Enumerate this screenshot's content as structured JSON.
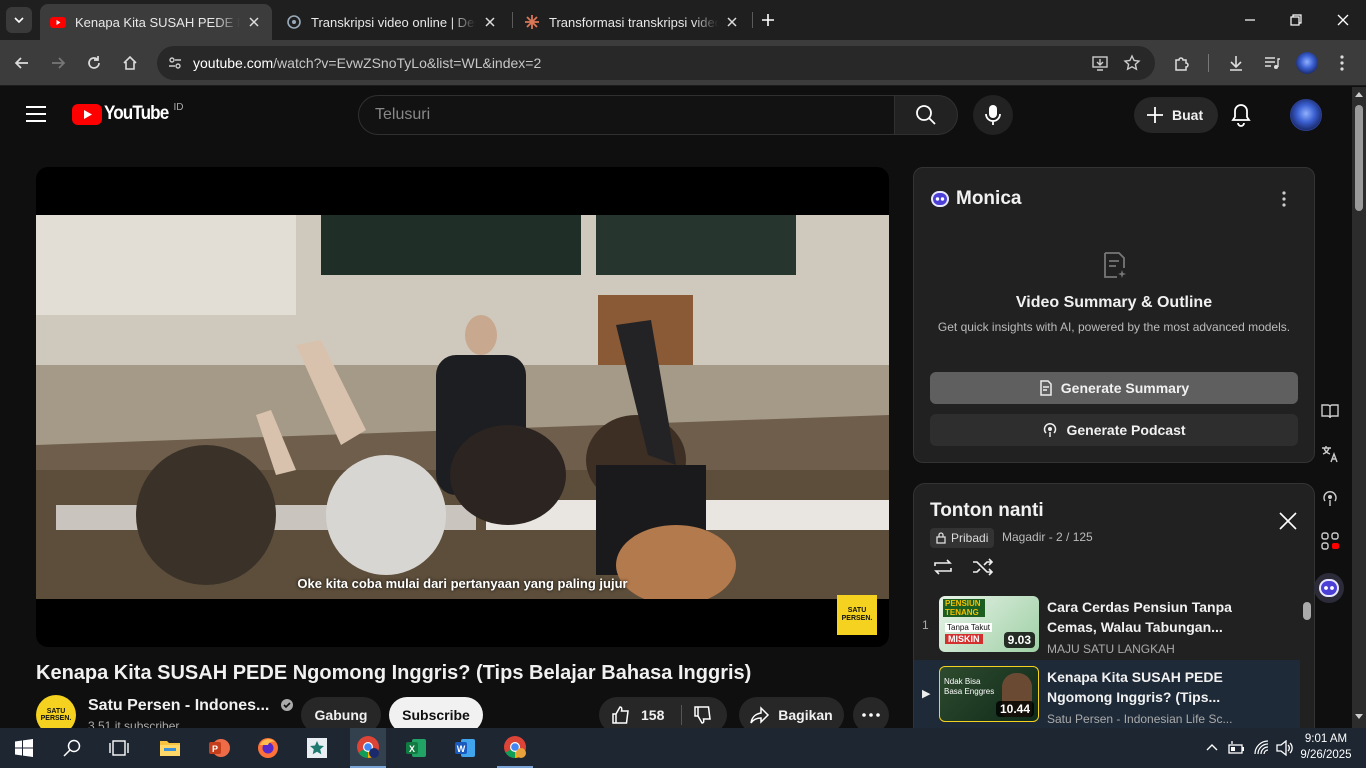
{
  "browser": {
    "tabs": [
      {
        "title": "Kenapa Kita SUSAH PEDE Ngomong Inggris?",
        "active": true
      },
      {
        "title": "Transkripsi video online | Descript",
        "active": false
      },
      {
        "title": "Transformasi transkripsi video menjadi",
        "active": false
      }
    ],
    "url_domain": "youtube.com",
    "url_path": "/watch?v=EvwZSnoTyLo&list=WL&index=2"
  },
  "youtube": {
    "region": "ID",
    "search_placeholder": "Telusuri",
    "create_label": "Buat"
  },
  "video": {
    "caption": "Oke kita coba mulai dari pertanyaan yang paling jujur",
    "watermark": "SATU PERSEN.",
    "title": "Kenapa Kita SUSAH PEDE Ngomong Inggris? (Tips Belajar Bahasa Inggris)",
    "channel": "Satu Persen - Indones...",
    "subscribers": "3,51 jt subscriber",
    "join_label": "Gabung",
    "subscribe_label": "Subscribe",
    "likes": "158",
    "share_label": "Bagikan"
  },
  "monica": {
    "brand": "Monica",
    "heading": "Video Summary & Outline",
    "subtitle": "Get quick insights with AI, powered by the most advanced models.",
    "summary_btn": "Generate Summary",
    "podcast_btn": "Generate Podcast"
  },
  "playlist": {
    "title": "Tonton nanti",
    "privacy": "Pribadi",
    "owner_progress": "Magadir - 2 / 125",
    "items": [
      {
        "index": "1",
        "title": "Cara Cerdas Pensiun Tanpa Cemas, Walau Tabungan...",
        "channel": "MAJU SATU LANGKAH",
        "duration": "9.03",
        "thumb_top": "PENSIUN TENANG",
        "thumb_mid": "Tanpa Takut",
        "thumb_bot": "MISKIN"
      },
      {
        "index": "▶",
        "title": "Kenapa Kita SUSAH PEDE Ngomong Inggris? (Tips...",
        "channel": "Satu Persen - Indonesian Life Sc...",
        "duration": "10.44",
        "thumb_top": "Ndak Bisa Basa Enggres",
        "thumb_mid": "",
        "thumb_bot": ""
      }
    ]
  },
  "taskbar": {
    "time": "9:01 AM",
    "date": "9/26/2025"
  },
  "colors": {
    "youtube_red": "#ff0000",
    "monica_accent": "#6a5cff",
    "taskbar": "#1d2631"
  }
}
